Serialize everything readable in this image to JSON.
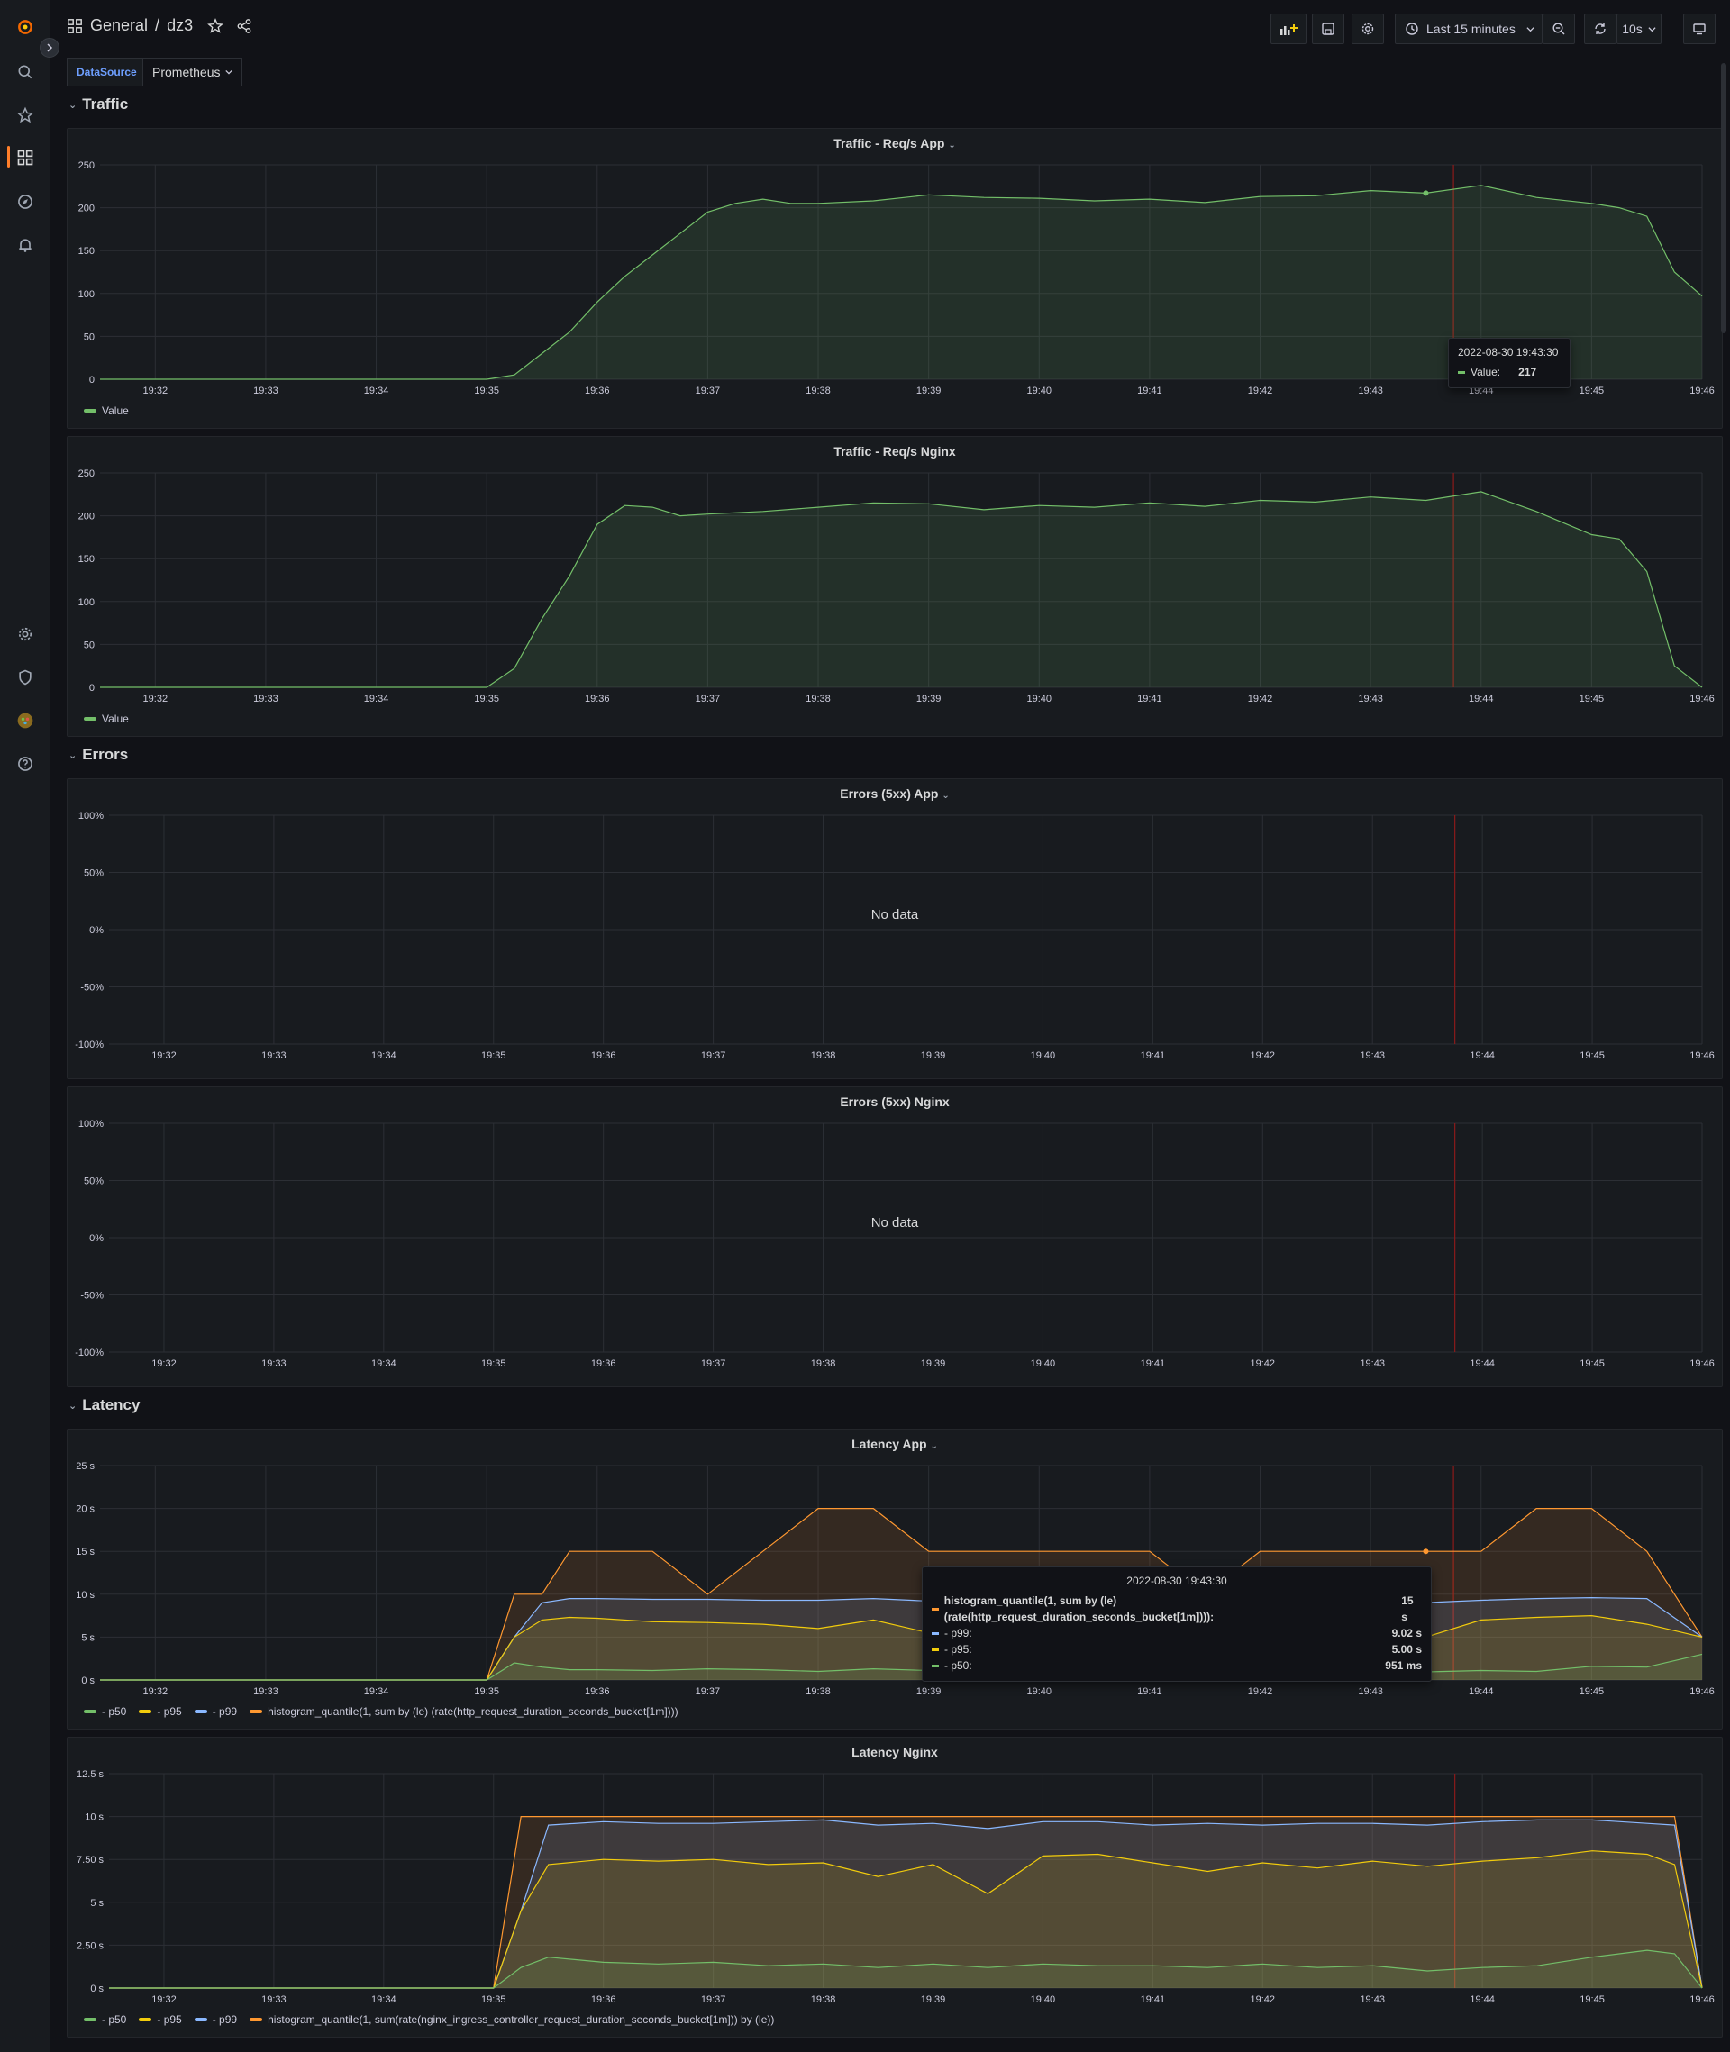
{
  "header": {
    "folder": "General",
    "separator": "/",
    "dashboard": "dz3",
    "time_range": "Last 15 minutes",
    "refresh": "10s"
  },
  "variables": {
    "label": "DataSource",
    "value": "Prometheus"
  },
  "rows": {
    "traffic": "Traffic",
    "errors": "Errors",
    "latency": "Latency"
  },
  "time_ticks_a": [
    "19:32",
    "19:33",
    "19:34",
    "19:35",
    "19:36",
    "19:37",
    "19:38",
    "19:39",
    "19:40",
    "19:41",
    "19:42",
    "19:43",
    "19:44",
    "19:45",
    "19:46"
  ],
  "panels": {
    "traffic_app": {
      "title": "Traffic - Req/s App",
      "yticks": [
        "250",
        "200",
        "150",
        "100",
        "50",
        "0"
      ],
      "legend": [
        "Value"
      ],
      "tooltip": {
        "time": "2022-08-30 19:43:30",
        "label": "Value:",
        "value": "217"
      }
    },
    "traffic_nginx": {
      "title": "Traffic - Req/s Nginx",
      "yticks": [
        "250",
        "200",
        "150",
        "100",
        "50",
        "0"
      ],
      "legend": [
        "Value"
      ]
    },
    "errors_app": {
      "title": "Errors (5xx) App",
      "yticks": [
        "100%",
        "50%",
        "0%",
        "-50%",
        "-100%"
      ],
      "nodata": "No data"
    },
    "errors_nginx": {
      "title": "Errors (5xx) Nginx",
      "yticks": [
        "100%",
        "50%",
        "0%",
        "-50%",
        "-100%"
      ],
      "nodata": "No data"
    },
    "latency_app": {
      "title": "Latency App",
      "yticks": [
        "25 s",
        "20 s",
        "15 s",
        "10 s",
        "5 s",
        "0 s"
      ],
      "legend": [
        "- p50",
        "- p95",
        "- p99",
        "histogram_quantile(1, sum by (le) (rate(http_request_duration_seconds_bucket[1m])))"
      ],
      "tooltip": {
        "time": "2022-08-30 19:43:30",
        "rows": [
          {
            "label": "histogram_quantile(1, sum by (le) (rate(http_request_duration_seconds_bucket[1m]))):",
            "value": "15 s"
          },
          {
            "label": "- p99:",
            "value": "9.02 s"
          },
          {
            "label": "- p95:",
            "value": "5.00 s"
          },
          {
            "label": "- p50:",
            "value": "951 ms"
          }
        ]
      }
    },
    "latency_nginx": {
      "title": "Latency Nginx",
      "yticks": [
        "12.5 s",
        "10 s",
        "7.50 s",
        "5 s",
        "2.50 s",
        "0 s"
      ],
      "legend": [
        "- p50",
        "- p95",
        "- p99",
        "histogram_quantile(1, sum(rate(nginx_ingress_controller_request_duration_seconds_bucket[1m])) by (le))"
      ]
    }
  },
  "colors": {
    "green": "#73bf69",
    "yellow": "#f2cc0c",
    "blue": "#8ab8ff",
    "orange": "#ff9830",
    "accent": "#ff7f2a"
  },
  "chart_data": [
    {
      "type": "area",
      "title": "Traffic - Req/s App",
      "x": [
        "19:31:30",
        "19:32",
        "19:33",
        "19:34",
        "19:35",
        "19:35:15",
        "19:35:30",
        "19:35:45",
        "19:36",
        "19:36:15",
        "19:36:30",
        "19:36:45",
        "19:37",
        "19:37:15",
        "19:37:30",
        "19:37:45",
        "19:38",
        "19:38:30",
        "19:39",
        "19:39:30",
        "19:40",
        "19:40:30",
        "19:41",
        "19:41:30",
        "19:42",
        "19:42:30",
        "19:43",
        "19:43:30",
        "19:44",
        "19:44:30",
        "19:45",
        "19:45:15",
        "19:45:30",
        "19:45:45",
        "19:46"
      ],
      "series": [
        {
          "name": "Value",
          "values": [
            0,
            0,
            0,
            0,
            0,
            5,
            30,
            55,
            90,
            120,
            145,
            170,
            195,
            205,
            210,
            205,
            205,
            208,
            215,
            212,
            211,
            208,
            210,
            206,
            213,
            214,
            220,
            217,
            226,
            212,
            205,
            200,
            190,
            125,
            97
          ]
        }
      ],
      "ylim": [
        0,
        250
      ]
    },
    {
      "type": "area",
      "title": "Traffic - Req/s Nginx",
      "x": [
        "19:31:30",
        "19:32",
        "19:33",
        "19:34",
        "19:35",
        "19:35:15",
        "19:35:30",
        "19:35:45",
        "19:36",
        "19:36:15",
        "19:36:30",
        "19:36:45",
        "19:37",
        "19:37:30",
        "19:38",
        "19:38:30",
        "19:39",
        "19:39:30",
        "19:40",
        "19:40:30",
        "19:41",
        "19:41:30",
        "19:42",
        "19:42:30",
        "19:43",
        "19:43:30",
        "19:44",
        "19:44:30",
        "19:45",
        "19:45:15",
        "19:45:30",
        "19:45:45",
        "19:46"
      ],
      "series": [
        {
          "name": "Value",
          "values": [
            0,
            0,
            0,
            0,
            0,
            22,
            80,
            130,
            190,
            212,
            210,
            200,
            202,
            205,
            210,
            215,
            214,
            207,
            212,
            210,
            215,
            211,
            218,
            216,
            222,
            218,
            228,
            205,
            178,
            173,
            135,
            25,
            0
          ]
        }
      ],
      "ylim": [
        0,
        250
      ]
    },
    {
      "type": "line",
      "title": "Errors (5xx) App",
      "series": [],
      "ylim": [
        -100,
        100
      ]
    },
    {
      "type": "line",
      "title": "Errors (5xx) Nginx",
      "series": [],
      "ylim": [
        -100,
        100
      ]
    },
    {
      "type": "area",
      "title": "Latency App",
      "x": [
        "19:31:30",
        "19:32",
        "19:33",
        "19:34",
        "19:35",
        "19:35:15",
        "19:35:30",
        "19:35:45",
        "19:36",
        "19:36:30",
        "19:37",
        "19:37:30",
        "19:38",
        "19:38:30",
        "19:39",
        "19:39:30",
        "19:40",
        "19:40:30",
        "19:41",
        "19:41:30",
        "19:42",
        "19:42:30",
        "19:43",
        "19:43:30",
        "19:44",
        "19:44:30",
        "19:45",
        "19:45:30",
        "19:46"
      ],
      "series": [
        {
          "name": "- p50",
          "values": [
            0,
            0,
            0,
            0,
            0,
            2,
            1.5,
            1.2,
            1.2,
            1.1,
            1.3,
            1.2,
            1.0,
            1.3,
            1.1,
            1.2,
            1.0,
            1.2,
            1.1,
            1.1,
            1.0,
            1.2,
            1.0,
            0.95,
            1.1,
            1.0,
            1.6,
            1.5,
            3.0
          ]
        },
        {
          "name": "- p95",
          "values": [
            0,
            0,
            0,
            0,
            0,
            5,
            7,
            7.3,
            7.2,
            6.8,
            6.7,
            6.5,
            6.0,
            7.0,
            5.5,
            6.0,
            5.5,
            6.0,
            5.8,
            5.5,
            5.0,
            5.5,
            5.0,
            5.0,
            7.0,
            7.3,
            7.5,
            6.5,
            5.0
          ]
        },
        {
          "name": "- p99",
          "values": [
            0,
            0,
            0,
            0,
            0,
            5,
            9,
            9.5,
            9.5,
            9.4,
            9.4,
            9.3,
            9.3,
            9.5,
            9.2,
            9.0,
            9.0,
            9.0,
            9.0,
            9.0,
            9.0,
            9.0,
            9.0,
            9.02,
            9.3,
            9.5,
            9.6,
            9.5,
            5.0
          ]
        },
        {
          "name": "histogram_quantile(1, sum by (le) (rate(http_request_duration_seconds_bucket[1m])))",
          "values": [
            0,
            0,
            0,
            0,
            0,
            10,
            10,
            15,
            15,
            15,
            10,
            15,
            20,
            20,
            15,
            15,
            15,
            15,
            15,
            10,
            15,
            15,
            15,
            15,
            15,
            20,
            20,
            15,
            5
          ]
        }
      ],
      "ylim": [
        0,
        25
      ]
    },
    {
      "type": "area",
      "title": "Latency Nginx",
      "x": [
        "19:31:30",
        "19:32",
        "19:33",
        "19:34",
        "19:35",
        "19:35:15",
        "19:35:30",
        "19:36",
        "19:36:30",
        "19:37",
        "19:37:30",
        "19:38",
        "19:38:30",
        "19:39",
        "19:39:30",
        "19:40",
        "19:40:30",
        "19:41",
        "19:41:30",
        "19:42",
        "19:42:30",
        "19:43",
        "19:43:30",
        "19:44",
        "19:44:30",
        "19:45",
        "19:45:30",
        "19:45:45",
        "19:46"
      ],
      "series": [
        {
          "name": "- p50",
          "values": [
            0,
            0,
            0,
            0,
            0,
            1.2,
            1.8,
            1.5,
            1.4,
            1.5,
            1.3,
            1.4,
            1.2,
            1.4,
            1.2,
            1.4,
            1.3,
            1.3,
            1.2,
            1.4,
            1.2,
            1.3,
            1.0,
            1.2,
            1.3,
            1.8,
            2.2,
            2.0,
            0
          ]
        },
        {
          "name": "- p95",
          "values": [
            0,
            0,
            0,
            0,
            0,
            4.5,
            7.2,
            7.5,
            7.4,
            7.5,
            7.2,
            7.3,
            6.5,
            7.2,
            5.5,
            7.7,
            7.8,
            7.3,
            6.8,
            7.3,
            7.0,
            7.4,
            7.1,
            7.4,
            7.6,
            8.0,
            7.8,
            7.2,
            0
          ]
        },
        {
          "name": "- p99",
          "values": [
            0,
            0,
            0,
            0,
            0,
            4.5,
            9.5,
            9.7,
            9.6,
            9.6,
            9.7,
            9.8,
            9.5,
            9.6,
            9.3,
            9.7,
            9.7,
            9.5,
            9.6,
            9.5,
            9.6,
            9.6,
            9.5,
            9.7,
            9.8,
            9.8,
            9.6,
            9.5,
            0
          ]
        },
        {
          "name": "histogram_quantile(1, sum(rate(nginx_ingress_controller_request_duration_seconds_bucket[1m])) by (le))",
          "values": [
            0,
            0,
            0,
            0,
            0,
            10,
            10,
            10,
            10,
            10,
            10,
            10,
            10,
            10,
            10,
            10,
            10,
            10,
            10,
            10,
            10,
            10,
            10,
            10,
            10,
            10,
            10,
            10,
            0
          ]
        }
      ],
      "ylim": [
        0,
        12.5
      ]
    }
  ]
}
